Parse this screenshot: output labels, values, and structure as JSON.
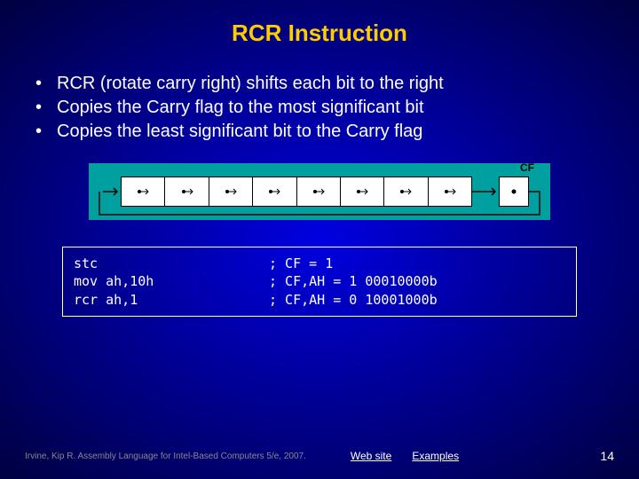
{
  "title": "RCR Instruction",
  "bullets": [
    "RCR (rotate carry right) shifts each bit to the right",
    "Copies the Carry flag to the most significant bit",
    "Copies the least significant bit to the Carry flag"
  ],
  "diagram": {
    "cf_label": "CF",
    "bit_count": 8
  },
  "code": [
    {
      "instr": "stc",
      "comment": "; CF = 1"
    },
    {
      "instr": "mov ah,10h",
      "comment": "; CF,AH = 1 00010000b"
    },
    {
      "instr": "rcr ah,1",
      "comment": "; CF,AH = 0 10001000b"
    }
  ],
  "footer": {
    "citation": "Irvine, Kip R. Assembly Language for Intel-Based Computers 5/e, 2007.",
    "link_web": "Web site",
    "link_examples": "Examples",
    "page": "14"
  }
}
